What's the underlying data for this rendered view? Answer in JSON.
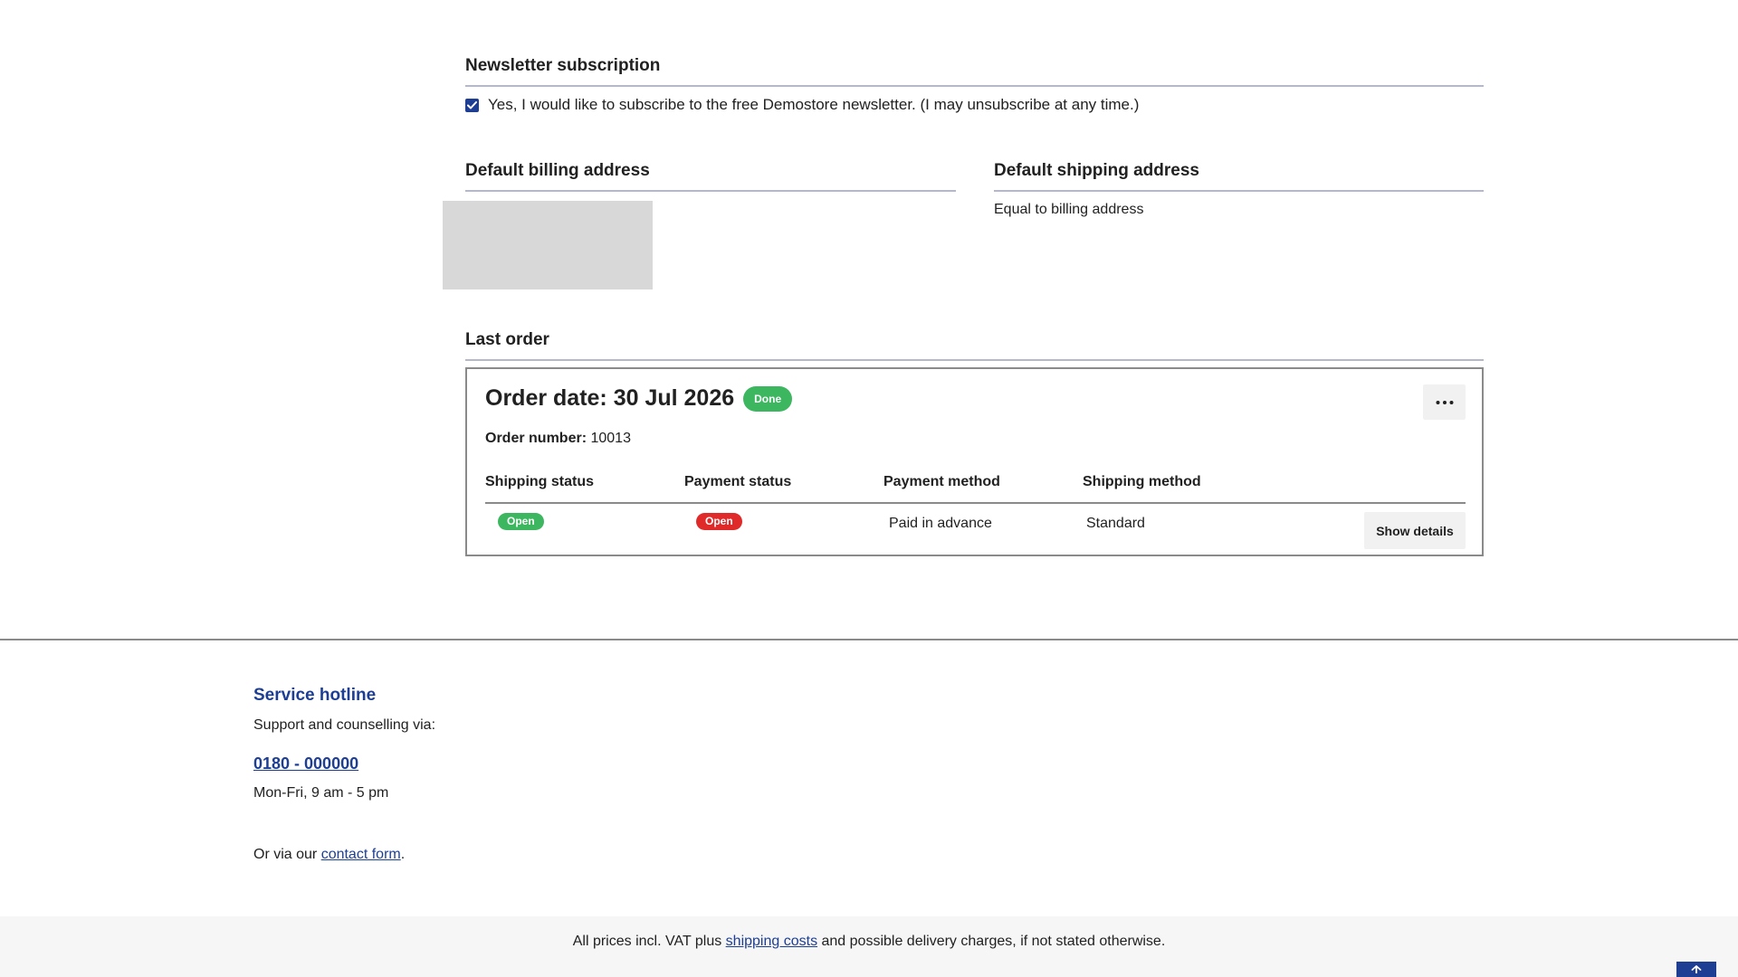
{
  "newsletter": {
    "title": "Newsletter subscription",
    "checkbox_label": "Yes, I would like to subscribe to the free Demostore newsletter. (I may unsubscribe at any time.)",
    "checked": true
  },
  "billing": {
    "title": "Default billing address"
  },
  "shipping": {
    "title": "Default shipping address",
    "text": "Equal to billing address"
  },
  "last_order": {
    "title": "Last order",
    "date_label": "Order date: 30 Jul 2026",
    "status_badge": "Done",
    "number_label": "Order number:",
    "number_value": "10013",
    "columns": [
      "Shipping status",
      "Payment status",
      "Payment method",
      "Shipping method"
    ],
    "shipping_status": "Open",
    "payment_status": "Open",
    "payment_method": "Paid in advance",
    "shipping_method": "Standard",
    "details_button": "Show details",
    "more_icon": "ellipsis-icon"
  },
  "service": {
    "title": "Service hotline",
    "subtitle": "Support and counselling via:",
    "phone": "0180 - 000000",
    "hours": "Mon-Fri, 9 am - 5 pm",
    "contact_prefix": "Or via our ",
    "contact_link": "contact form",
    "contact_suffix": "."
  },
  "footer": {
    "prefix": "All prices incl. VAT plus ",
    "link": "shipping costs",
    "suffix": " and possible delivery charges, if not stated otherwise."
  },
  "colors": {
    "brand": "#1d3e93",
    "success": "#3cb760",
    "danger": "#e02a2a"
  }
}
